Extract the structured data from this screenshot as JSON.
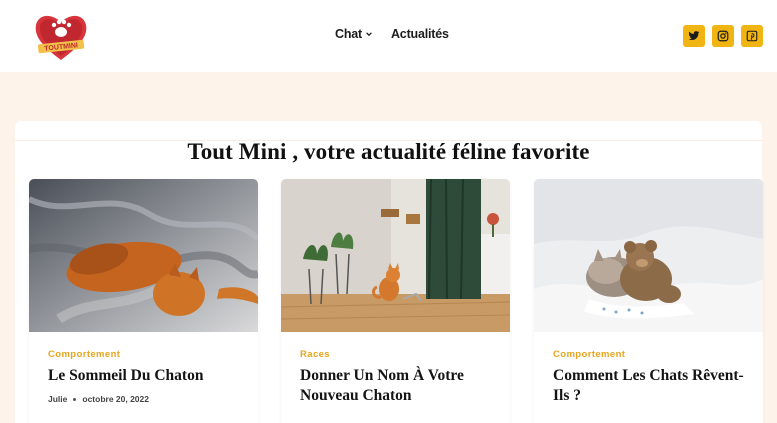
{
  "header": {
    "logo_text": "TOUTMINI",
    "nav": [
      {
        "label": "Chat",
        "has_dropdown": true
      },
      {
        "label": "Actualités",
        "has_dropdown": false
      }
    ],
    "socials": [
      {
        "icon": "twitter-icon"
      },
      {
        "icon": "instagram-icon"
      },
      {
        "icon": "pinterest-icon"
      }
    ],
    "accent_color": "#f0b413"
  },
  "main": {
    "title": "Tout Mini , votre actualité féline favorite",
    "posts": [
      {
        "category": "Comportement",
        "title": "Le Sommeil Du Chaton",
        "author": "Julie",
        "date": "octobre 20, 2022"
      },
      {
        "category": "Races",
        "title": "Donner Un Nom À Votre Nouveau Chaton",
        "author": "",
        "date": ""
      },
      {
        "category": "Comportement",
        "title": "Comment Les Chats Rêvent-Ils ?",
        "author": "",
        "date": ""
      }
    ]
  }
}
